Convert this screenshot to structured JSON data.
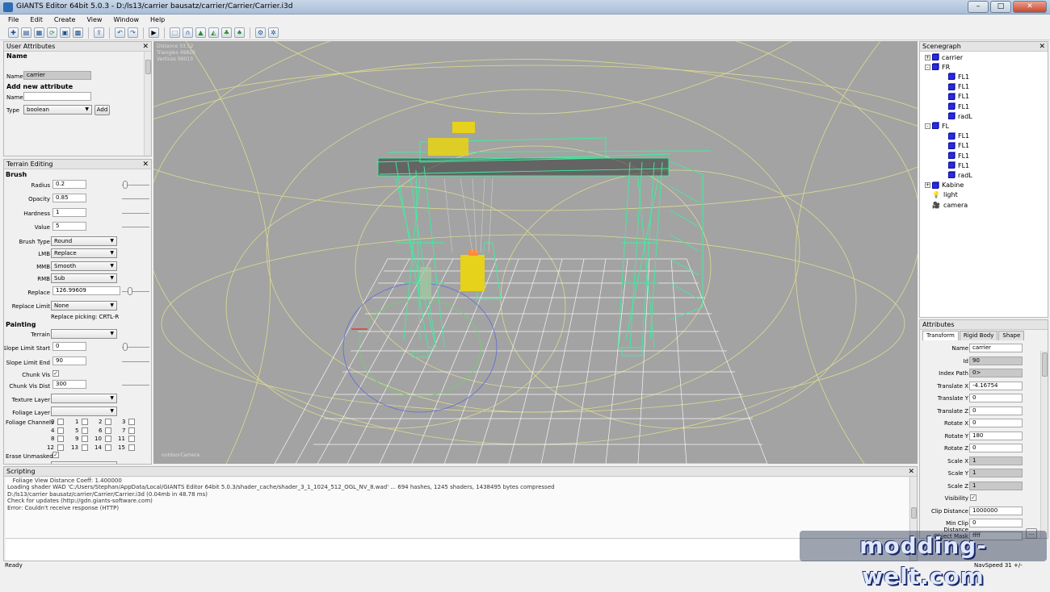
{
  "window": {
    "title": "GIANTS Editor 64bit 5.0.3 - D:/ls13/carrier bausatz/carrier/Carrier/Carrier.i3d"
  },
  "menu": [
    "File",
    "Edit",
    "Create",
    "View",
    "Window",
    "Help"
  ],
  "user_attributes": {
    "header": "User Attributes",
    "name_heading": "Name",
    "name_label": "Name",
    "name_value": "carrier",
    "add_heading": "Add new attribute",
    "new_name_label": "Name",
    "new_name_value": "",
    "type_label": "Type",
    "type_value": "boolean",
    "add_button": "Add"
  },
  "terrain_editing": {
    "header": "Terrain Editing",
    "brush_heading": "Brush",
    "radius_label": "Radius",
    "radius_value": "0.2",
    "opacity_label": "Opacity",
    "opacity_value": "0.85",
    "hardness_label": "Hardness",
    "hardness_value": "1",
    "value_label": "Value",
    "value_value": "5",
    "brush_type_label": "Brush Type",
    "brush_type_value": "Round",
    "lmb_label": "LMB",
    "lmb_value": "Replace",
    "mmb_label": "MMB",
    "mmb_value": "Smooth",
    "rmb_label": "RMB",
    "rmb_value": "Sub",
    "replace_label": "Replace",
    "replace_value": "126.99609",
    "replace_limit_label": "Replace Limit",
    "replace_limit_value": "None",
    "replace_picking": "Replace picking: CRTL-R",
    "painting_heading": "Painting",
    "terrain_label": "Terrain",
    "terrain_value": "",
    "slope_start_label": "Slope Limit Start",
    "slope_start_value": "0",
    "slope_end_label": "Slope Limit End",
    "slope_end_value": "90",
    "chunk_vis_label": "Chunk Vis",
    "chunk_vis_dist_label": "Chunk Vis Dist",
    "chunk_vis_dist_value": "300",
    "texture_layer_label": "Texture Layer",
    "foliage_layer_label": "Foliage Layer",
    "foliage_channels_label": "Foliage Channels",
    "channels": [
      "0",
      "1",
      "2",
      "3",
      "4",
      "5",
      "6",
      "7",
      "8",
      "9",
      "10",
      "11",
      "12",
      "13",
      "14",
      "15"
    ],
    "erase_unmasked_label": "Erase Unmasked"
  },
  "viewport": {
    "info_distance": "Distance 33.52",
    "info_triangles": "Triangles 49820",
    "info_vertices": "Vertices 99013",
    "camera_label": "outdoorCamera"
  },
  "scenegraph": {
    "header": "Scenegraph",
    "nodes": [
      {
        "label": "carrier",
        "depth": 0,
        "expander": "+",
        "icon": "cube"
      },
      {
        "label": "FR",
        "depth": 0,
        "expander": "-",
        "icon": "cube"
      },
      {
        "label": "FL1",
        "depth": 1,
        "expander": "",
        "icon": "cube"
      },
      {
        "label": "FL1",
        "depth": 1,
        "expander": "",
        "icon": "cube"
      },
      {
        "label": "FL1",
        "depth": 1,
        "expander": "",
        "icon": "cube"
      },
      {
        "label": "FL1",
        "depth": 1,
        "expander": "",
        "icon": "cube"
      },
      {
        "label": "radL",
        "depth": 1,
        "expander": "",
        "icon": "cube"
      },
      {
        "label": "FL",
        "depth": 0,
        "expander": "-",
        "icon": "cube"
      },
      {
        "label": "FL1",
        "depth": 1,
        "expander": "",
        "icon": "cube"
      },
      {
        "label": "FL1",
        "depth": 1,
        "expander": "",
        "icon": "cube"
      },
      {
        "label": "FL1",
        "depth": 1,
        "expander": "",
        "icon": "cube"
      },
      {
        "label": "FL1",
        "depth": 1,
        "expander": "",
        "icon": "cube"
      },
      {
        "label": "radL",
        "depth": 1,
        "expander": "",
        "icon": "cube"
      },
      {
        "label": "Kabine",
        "depth": 0,
        "expander": "+",
        "icon": "cube"
      },
      {
        "label": "light",
        "depth": 0,
        "expander": "",
        "icon": "bulb"
      },
      {
        "label": "camera",
        "depth": 0,
        "expander": "",
        "icon": "camera"
      }
    ]
  },
  "attributes": {
    "header": "Attributes",
    "tabs": [
      "Transform",
      "Rigid Body",
      "Shape"
    ],
    "fields": [
      {
        "label": "Name",
        "value": "carrier",
        "gray": false
      },
      {
        "label": "Id",
        "value": "90",
        "gray": true
      },
      {
        "label": "Index Path",
        "value": "0>",
        "gray": true
      },
      {
        "label": "Translate X",
        "value": "-4.16754",
        "gray": false
      },
      {
        "label": "Translate Y",
        "value": "0",
        "gray": false
      },
      {
        "label": "Translate Z",
        "value": "0",
        "gray": false
      },
      {
        "label": "Rotate X",
        "value": "0",
        "gray": false
      },
      {
        "label": "Rotate Y",
        "value": "180",
        "gray": false
      },
      {
        "label": "Rotate Z",
        "value": "0",
        "gray": false
      },
      {
        "label": "Scale X",
        "value": "1",
        "gray": true
      },
      {
        "label": "Scale Y",
        "value": "1",
        "gray": true
      },
      {
        "label": "Scale Z",
        "value": "1",
        "gray": true
      },
      {
        "label": "Visibility",
        "value": "",
        "gray": false
      },
      {
        "label": "Clip Distance",
        "value": "1000000",
        "gray": false
      },
      {
        "label": "Min Clip Distance",
        "value": "0",
        "gray": false
      },
      {
        "label": "Object Mask",
        "value": "ffff",
        "gray": false
      }
    ]
  },
  "scripting": {
    "header": "Scripting",
    "lines": [
      "   Foliage View Distance Coeff: 1.400000",
      "Loading shader WAD 'C:/Users/Stephan/AppData/Local/GIANTS Editor 64bit 5.0.3/shader_cache/shader_3_1_1024_512_OGL_NV_8.wad' ... 694 hashes, 1245 shaders, 1438495 bytes compressed",
      "D:/ls13/carrier bausatz/carrier/Carrier/Carrier.i3d (0.04mb in 48.78 ms)",
      "Check for updates (http://gdn.giants-software.com)",
      "Error: Couldn't receive response (HTTP)"
    ]
  },
  "status": {
    "left": "Ready",
    "nav_speed": "NavSpeed 31 +/-"
  },
  "watermark": "modding-welt.com",
  "colors": {
    "viewport_bg": "#a3a3a3",
    "wireframe": "#3cf0a0",
    "guides": "#e6e68c",
    "crane_yellow": "#e6d21a",
    "node_blue": "#2a2ae0"
  }
}
